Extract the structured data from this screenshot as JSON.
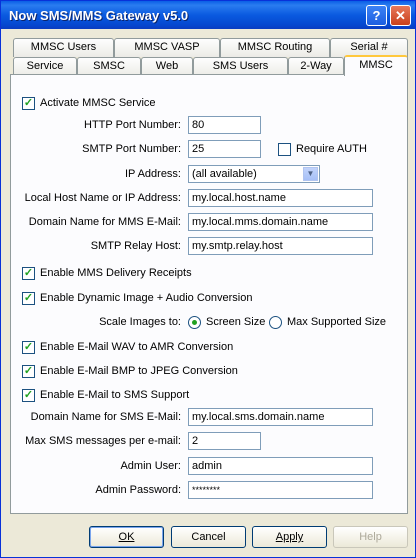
{
  "window": {
    "title": "Now SMS/MMS Gateway v5.0"
  },
  "titlebar_buttons": {
    "help": "?",
    "close": "✕"
  },
  "tabs_row1": [
    "MMSC Users",
    "MMSC VASP",
    "MMSC Routing",
    "Serial #"
  ],
  "tabs_row2": [
    "Service",
    "SMSC",
    "Web",
    "SMS Users",
    "2-Way",
    "MMSC"
  ],
  "active_tab": "MMSC",
  "form": {
    "activate_label": "Activate MMSC Service",
    "http_port_label": "HTTP Port Number:",
    "http_port_value": "80",
    "smtp_port_label": "SMTP Port Number:",
    "smtp_port_value": "25",
    "require_auth_label": "Require AUTH",
    "ip_label": "IP Address:",
    "ip_value": "(all available)",
    "local_host_label": "Local Host Name or IP Address:",
    "local_host_value": "my.local.host.name",
    "mms_domain_label": "Domain Name for MMS E-Mail:",
    "mms_domain_value": "my.local.mms.domain.name",
    "relay_label": "SMTP Relay Host:",
    "relay_value": "my.smtp.relay.host",
    "delivery_receipts_label": "Enable MMS Delivery Receipts",
    "dynamic_label": "Enable Dynamic Image + Audio Conversion",
    "scale_label": "Scale Images to:",
    "scale_screen_label": "Screen Size",
    "scale_max_label": "Max Supported Size",
    "wav_label": "Enable E-Mail WAV to AMR Conversion",
    "bmp_label": "Enable E-Mail BMP to JPEG Conversion",
    "email_sms_label": "Enable E-Mail to SMS Support",
    "sms_domain_label": "Domain Name for SMS E-Mail:",
    "sms_domain_value": "my.local.sms.domain.name",
    "max_sms_label": "Max SMS messages per e-mail:",
    "max_sms_value": "2",
    "admin_user_label": "Admin User:",
    "admin_user_value": "admin",
    "admin_pass_label": "Admin Password:",
    "admin_pass_value": "********"
  },
  "buttons": {
    "ok": "OK",
    "cancel": "Cancel",
    "apply": "Apply",
    "help": "Help"
  }
}
